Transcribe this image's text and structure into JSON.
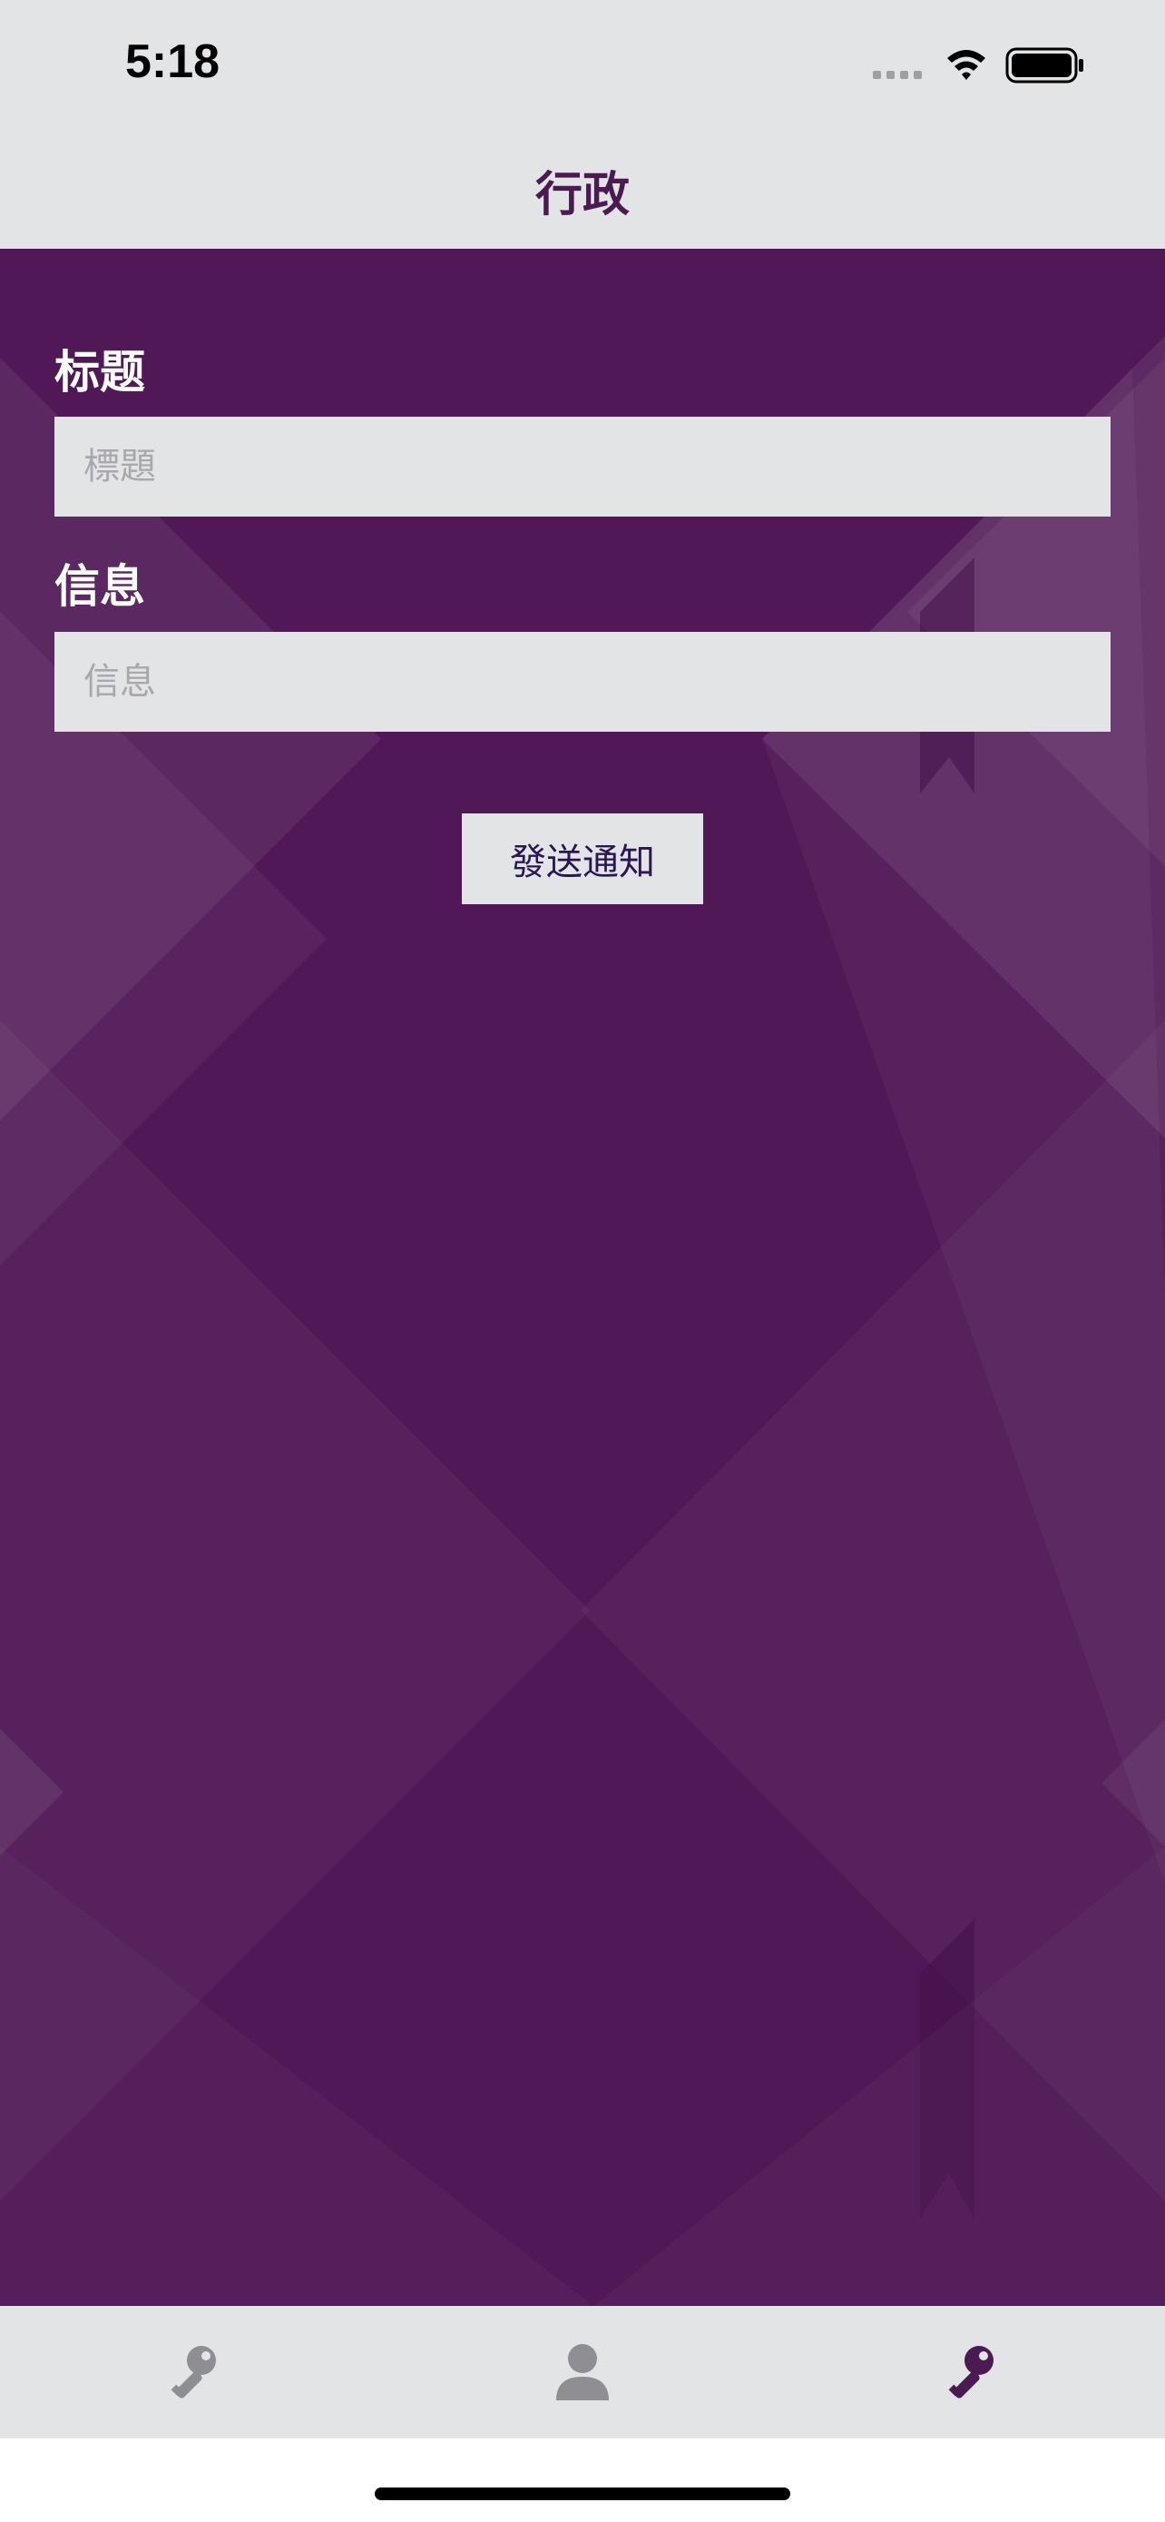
{
  "status_bar": {
    "time": "5:18"
  },
  "nav": {
    "title": "行政"
  },
  "form": {
    "title_label": "标题",
    "title_placeholder": "標題",
    "message_label": "信息",
    "message_placeholder": "信息",
    "send_button_label": "發送通知"
  },
  "tab_bar": {
    "items": [
      {
        "icon": "key-icon",
        "selected": false
      },
      {
        "icon": "person-icon",
        "selected": false
      },
      {
        "icon": "key-icon",
        "selected": true
      }
    ]
  },
  "colors": {
    "background_purple": "#501856",
    "bar_gray": "#e3e4e6",
    "accent": "#4c1a52",
    "inactive_icon": "#8e8e93"
  }
}
